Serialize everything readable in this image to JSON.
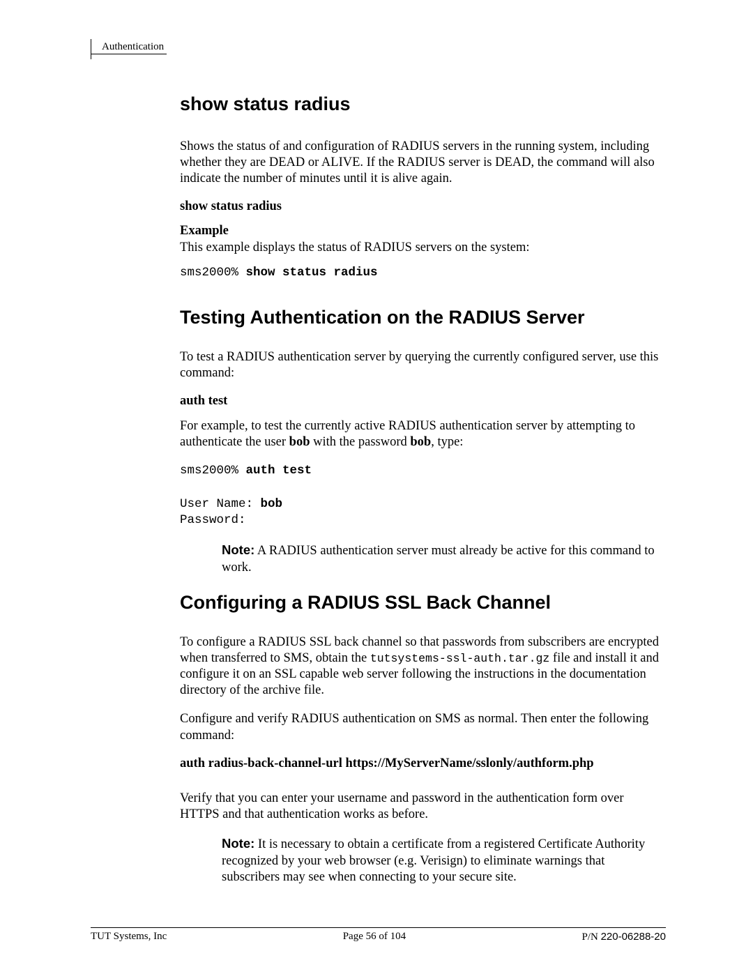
{
  "header": {
    "section": "Authentication"
  },
  "sections": {
    "showStatus": {
      "title": "show status radius",
      "desc": "Shows the status of and configuration of RADIUS servers in the running system, including whether they are DEAD or ALIVE.  If the RADIUS server is DEAD, the command will also indicate the number of minutes until it is alive again.",
      "syntax": "show status radius",
      "exampleLabel": "Example",
      "exampleDesc": "This example displays the status of RADIUS servers on the system:",
      "prompt": "sms2000% ",
      "cmd": "show status radius"
    },
    "testingAuth": {
      "title": "Testing Authentication on the RADIUS Server",
      "intro": "To test a RADIUS authentication server by querying the currently configured server, use this command:",
      "syntax": "auth test",
      "exampleDescPre": "For example, to test the currently active RADIUS authentication server by attempting to authenticate the user ",
      "user": "bob",
      "exampleDescMid": " with the password ",
      "pass": "bob",
      "exampleDescPost": ", type:",
      "prompt1": "sms2000% ",
      "cmd1": "auth test",
      "lineUserLabel": "User Name: ",
      "lineUserVal": "bob",
      "linePass": "Password:",
      "noteLabel": "Note:",
      "noteText": "  A RADIUS authentication server must already be active for this command to work."
    },
    "sslBack": {
      "title": "Configuring a RADIUS SSL Back Channel",
      "p1a": "To configure a RADIUS SSL back channel so that passwords from subscribers are encrypted when transferred to SMS, obtain the ",
      "file": "tutsystems-ssl-auth.tar.gz",
      "p1b": " file and install it and configure it on an SSL capable web server following the instructions in the documentation directory of the archive file.",
      "p2": "Configure and verify RADIUS authentication on SMS as normal.  Then enter the following command:",
      "cmd": "auth radius-back-channel-url https://MyServerName/sslonly/authform.php",
      "p3": "Verify that you can enter your username and password in the authentication form over HTTPS and that authentication works as before.",
      "noteLabel": "Note:",
      "noteText": "  It is necessary to obtain a certificate from a registered Certificate Authority recognized by your web browser (e.g. Verisign) to eliminate warnings that subscribers may see when connecting to your secure site."
    }
  },
  "footer": {
    "left": "TUT Systems, Inc",
    "center": "Page 56 of 104",
    "pnLabel": "P/N ",
    "pnNum": "220-06288-20"
  }
}
